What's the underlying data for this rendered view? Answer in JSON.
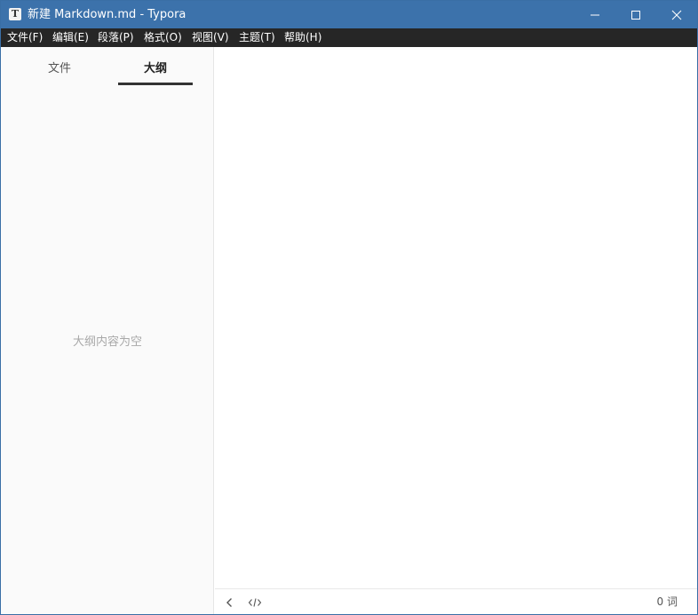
{
  "window": {
    "title": "新建 Markdown.md - Typora",
    "app_icon_glyph": "T",
    "colors": {
      "titlebar": "#3c72ab",
      "menubar": "#262626",
      "sidebar": "#fafafa"
    }
  },
  "menu": {
    "items": [
      {
        "label": "文件(F)"
      },
      {
        "label": "编辑(E)"
      },
      {
        "label": "段落(P)"
      },
      {
        "label": "格式(O)"
      },
      {
        "label": "视图(V)"
      },
      {
        "label": "主题(T)"
      },
      {
        "label": "帮助(H)"
      }
    ]
  },
  "sidebar": {
    "tabs": [
      {
        "label": "文件",
        "active": false
      },
      {
        "label": "大纲",
        "active": true
      }
    ],
    "empty_message": "大纲内容为空"
  },
  "footer": {
    "icons": [
      "chevron-left-icon",
      "code-icon"
    ],
    "word_count": "0 词"
  }
}
